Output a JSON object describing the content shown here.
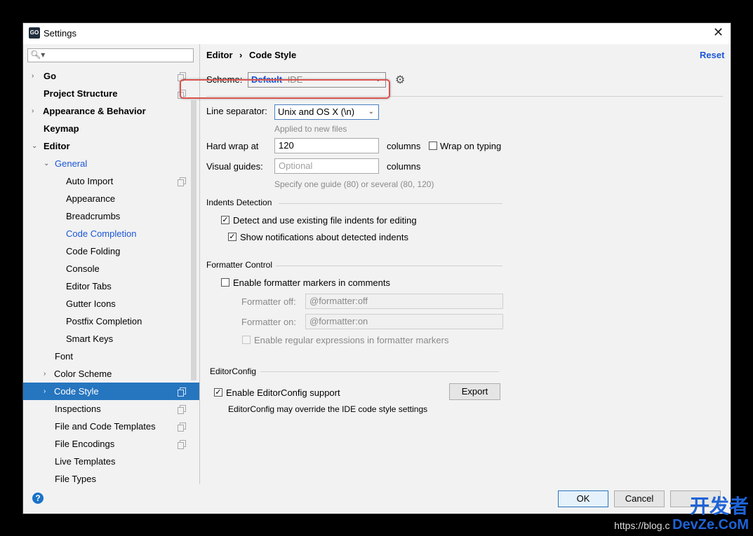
{
  "window": {
    "title": "Settings",
    "app_icon": "GO"
  },
  "search": {
    "placeholder": ""
  },
  "sidebar": {
    "items": [
      {
        "label": "Go"
      },
      {
        "label": "Project Structure"
      },
      {
        "label": "Appearance & Behavior"
      },
      {
        "label": "Keymap"
      },
      {
        "label": "Editor"
      },
      {
        "label": "General"
      },
      {
        "label": "Auto Import"
      },
      {
        "label": "Appearance"
      },
      {
        "label": "Breadcrumbs"
      },
      {
        "label": "Code Completion"
      },
      {
        "label": "Code Folding"
      },
      {
        "label": "Console"
      },
      {
        "label": "Editor Tabs"
      },
      {
        "label": "Gutter Icons"
      },
      {
        "label": "Postfix Completion"
      },
      {
        "label": "Smart Keys"
      },
      {
        "label": "Font"
      },
      {
        "label": "Color Scheme"
      },
      {
        "label": "Code Style"
      },
      {
        "label": "Inspections"
      },
      {
        "label": "File and Code Templates"
      },
      {
        "label": "File Encodings"
      },
      {
        "label": "Live Templates"
      },
      {
        "label": "File Types"
      }
    ]
  },
  "breadcrumb": {
    "parent": "Editor",
    "separator": "›",
    "current": "Code Style",
    "reset": "Reset"
  },
  "scheme": {
    "label": "Scheme:",
    "name": "Default",
    "scope": "IDE"
  },
  "line_separator": {
    "label": "Line separator:",
    "value": "Unix and OS X (\\n)",
    "hint": "Applied to new files"
  },
  "hard_wrap": {
    "label": "Hard wrap at",
    "value": "120",
    "unit": "columns",
    "wrap_on_typing": "Wrap on typing"
  },
  "visual_guides": {
    "label": "Visual guides:",
    "placeholder": "Optional",
    "unit": "columns",
    "hint": "Specify one guide (80) or several (80, 120)"
  },
  "indents": {
    "title": "Indents Detection",
    "detect": "Detect and use existing file indents for editing",
    "notify": "Show notifications about detected indents"
  },
  "formatter": {
    "title": "Formatter Control",
    "enable": "Enable formatter markers in comments",
    "off_label": "Formatter off:",
    "off_value": "@formatter:off",
    "on_label": "Formatter on:",
    "on_value": "@formatter:on",
    "regex": "Enable regular expressions in formatter markers"
  },
  "editorconfig": {
    "title": "EditorConfig",
    "enable": "Enable EditorConfig support",
    "export": "Export",
    "note": "EditorConfig may override the IDE code style settings"
  },
  "footer": {
    "ok": "OK",
    "cancel": "Cancel",
    "help": "?"
  },
  "watermark": {
    "url": "https://blog.c",
    "brand_cn": "开发者",
    "brand_en": "DevZe.CoM"
  },
  "colors": {
    "accent": "#2675bf",
    "link": "#1b56d6",
    "highlight": "#d9534f"
  }
}
